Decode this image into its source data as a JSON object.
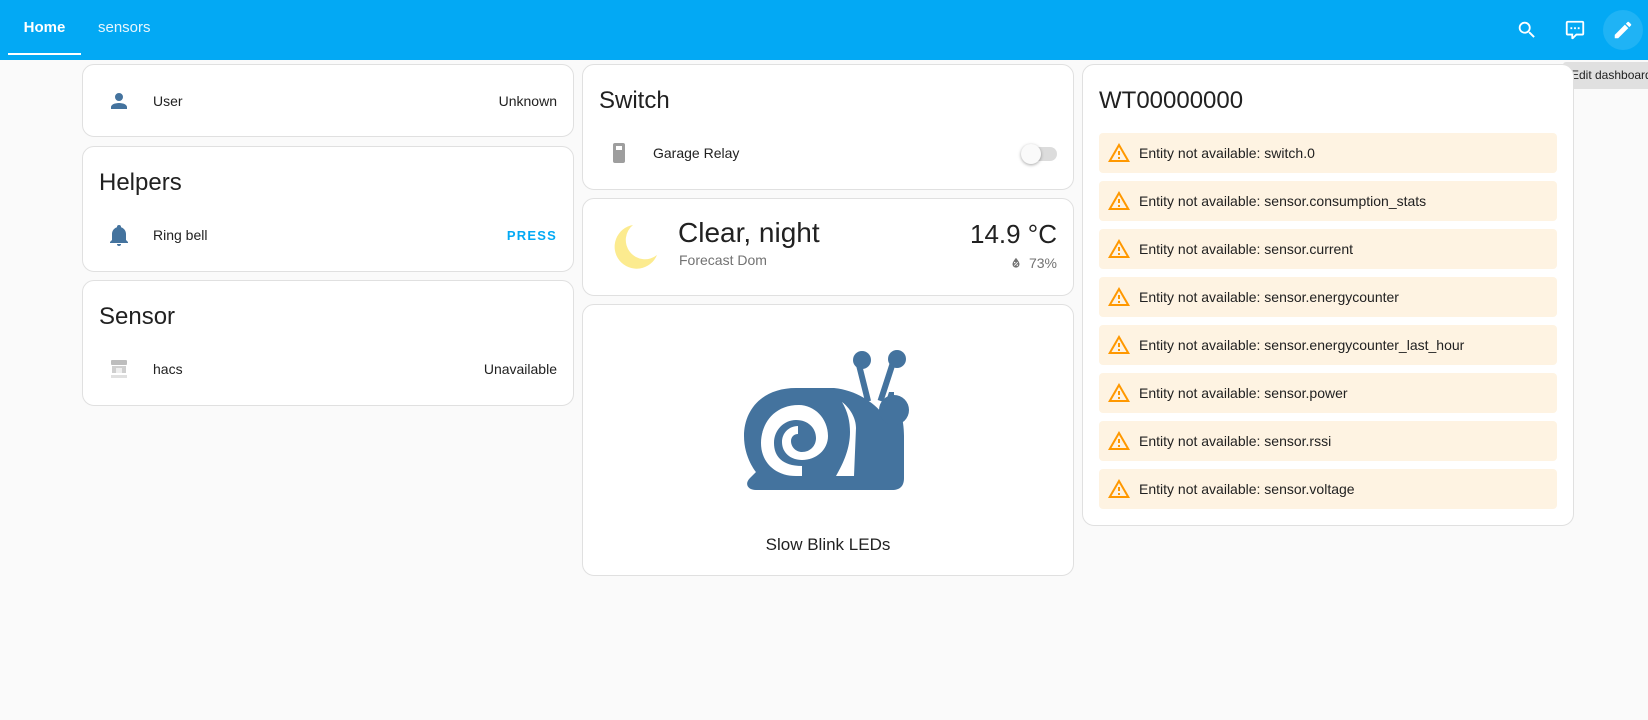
{
  "topbar": {
    "tabs": [
      "Home",
      "sensors"
    ],
    "icons": [
      "search-icon",
      "assist-icon",
      "pencil-icon"
    ],
    "tooltip": "Edit dashboard",
    "color": "#03a9f4"
  },
  "col1": {
    "user": {
      "name": "User",
      "state": "Unknown"
    },
    "helpers": {
      "title": "Helpers",
      "name": "Ring bell",
      "action": "PRESS"
    },
    "sensor": {
      "title": "Sensor",
      "name": "hacs",
      "state": "Unavailable"
    }
  },
  "col2": {
    "switch": {
      "title": "Switch",
      "name": "Garage Relay",
      "state": "off"
    },
    "weather": {
      "condition": "Clear, night",
      "name": "Forecast Dom",
      "temperature": "14.9 °C",
      "humidity": "73%"
    },
    "button": {
      "label": "Slow Blink LEDs",
      "icon": "snail-icon",
      "icon_color": "#44739e"
    }
  },
  "col3": {
    "title": "WT00000000",
    "warnings": [
      "Entity not available: switch.0",
      "Entity not available: sensor.consumption_stats",
      "Entity not available: sensor.current",
      "Entity not available: sensor.energycounter",
      "Entity not available: sensor.energycounter_last_hour",
      "Entity not available: sensor.power",
      "Entity not available: sensor.rssi",
      "Entity not available: sensor.voltage"
    ],
    "warning_color": "#ff9800"
  }
}
